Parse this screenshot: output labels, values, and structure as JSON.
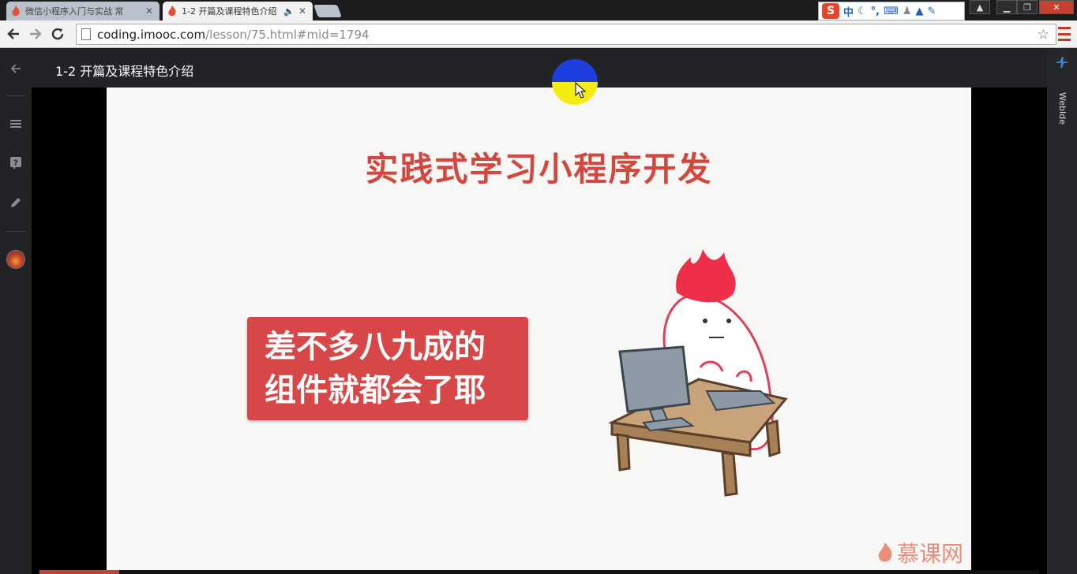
{
  "tabs": [
    {
      "title": "微信小程序入门与实战 常",
      "active": false
    },
    {
      "title": "1-2 开篇及课程特色介绍",
      "active": true
    }
  ],
  "ime": {
    "mode_label": "中"
  },
  "toolbar": {
    "url_host": "coding.imooc.com",
    "url_path": "/lesson/75.html#mid=1794"
  },
  "lesson": {
    "title": "1-2 开篇及课程特色介绍"
  },
  "rightbar": {
    "webide_label": "WebIde"
  },
  "slide": {
    "title": "实践式学习小程序开发",
    "callout_line1": "差不多八九成的",
    "callout_line2": "组件就都会了耶",
    "watermark": "慕课网"
  },
  "player": {
    "progress_fraction": 0.08
  },
  "colors": {
    "accent": "#d3473e",
    "callout_bg": "#d84747",
    "sidebar_bg": "#222326",
    "progress": "#c7412f"
  },
  "icons": [
    "back-arrow-icon",
    "menu-icon",
    "question-icon",
    "pencil-icon",
    "avatar",
    "webide-icon",
    "star-icon",
    "reload-icon"
  ]
}
